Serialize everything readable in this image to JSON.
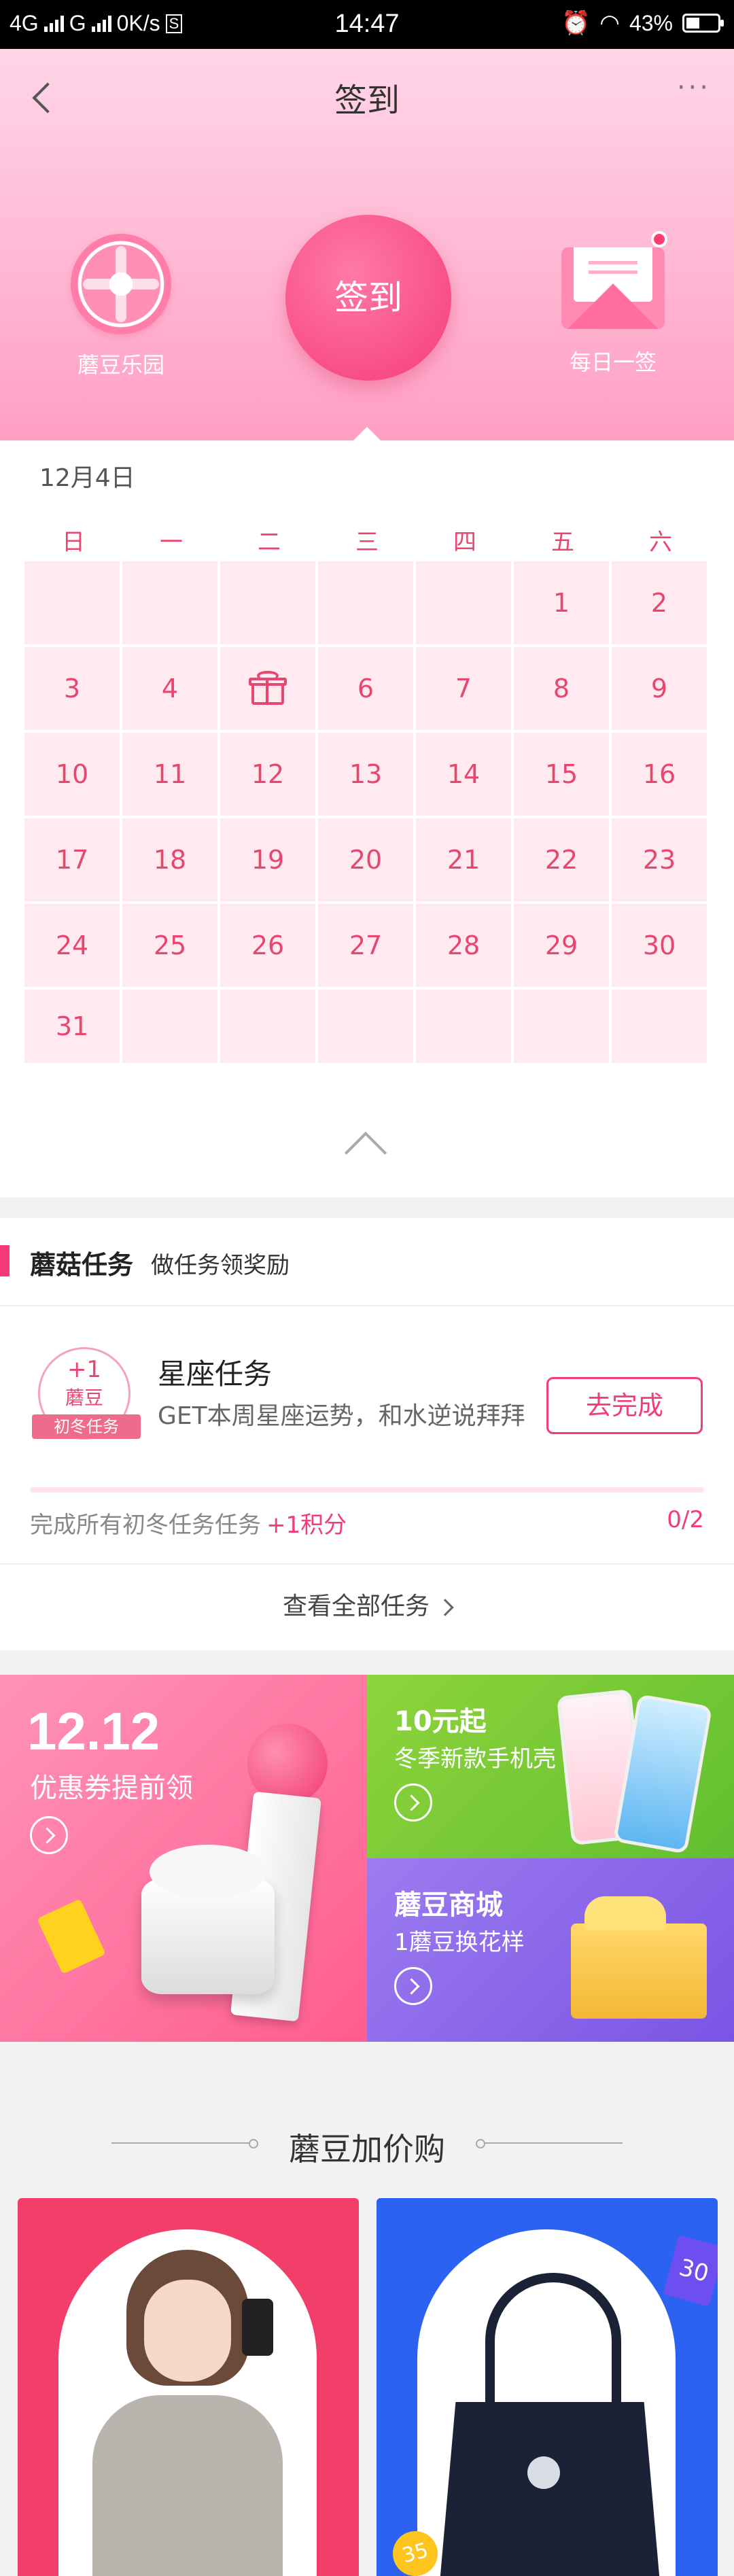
{
  "status_bar": {
    "network1": "4G",
    "network2": "G",
    "speed": "0K/s",
    "s_icon": "S",
    "time": "14:47",
    "battery": "43%",
    "battery_level": 0.43,
    "icons": [
      "alarm-icon",
      "wifi-icon",
      "battery-icon"
    ]
  },
  "header": {
    "title": "签到",
    "more": "···",
    "left_label": "蘑豆乐园",
    "sign_label": "签到",
    "right_label": "每日一签",
    "colors": {
      "accent": "#f53c78",
      "header_top": "#ffd6e7",
      "header_bottom": "#ff9fc4"
    }
  },
  "calendar": {
    "date": "12月4日",
    "weekdays": [
      "日",
      "一",
      "二",
      "三",
      "四",
      "五",
      "六"
    ],
    "rows": [
      [
        "",
        "",
        "",
        "",
        "",
        "1",
        "2"
      ],
      [
        "3",
        "4",
        "gift",
        "6",
        "7",
        "8",
        "9"
      ],
      [
        "10",
        "11",
        "12",
        "13",
        "14",
        "15",
        "16"
      ],
      [
        "17",
        "18",
        "19",
        "20",
        "21",
        "22",
        "23"
      ],
      [
        "24",
        "25",
        "26",
        "27",
        "28",
        "29",
        "30"
      ],
      [
        "31",
        "",
        "",
        "",
        "",
        "",
        ""
      ]
    ],
    "gift_day_icon": "gift-icon"
  },
  "tasks": {
    "section_title": "蘑菇任务",
    "section_sub": "做任务领奖励",
    "badge": {
      "plus": "+1",
      "unit": "蘑豆",
      "ribbon": "初冬任务"
    },
    "task_name": "星座任务",
    "task_desc": "GET本周星座运势，和水逆说拜拜",
    "action_button": "去完成",
    "progress_text": "完成所有初冬任务任务",
    "progress_points": "+1积分",
    "progress_count": "0/2",
    "progress_fraction": 0,
    "view_all": "查看全部任务"
  },
  "promos": {
    "left": {
      "big": "12.12",
      "sub": "优惠券提前领"
    },
    "right_top": {
      "title": "10元起",
      "sub": "冬季新款手机壳"
    },
    "right_bottom": {
      "title": "蘑豆商城",
      "sub": "1蘑豆换花样"
    }
  },
  "bottom": {
    "section_title": "蘑豆加价购",
    "tag30": "30",
    "tag35": "35"
  }
}
